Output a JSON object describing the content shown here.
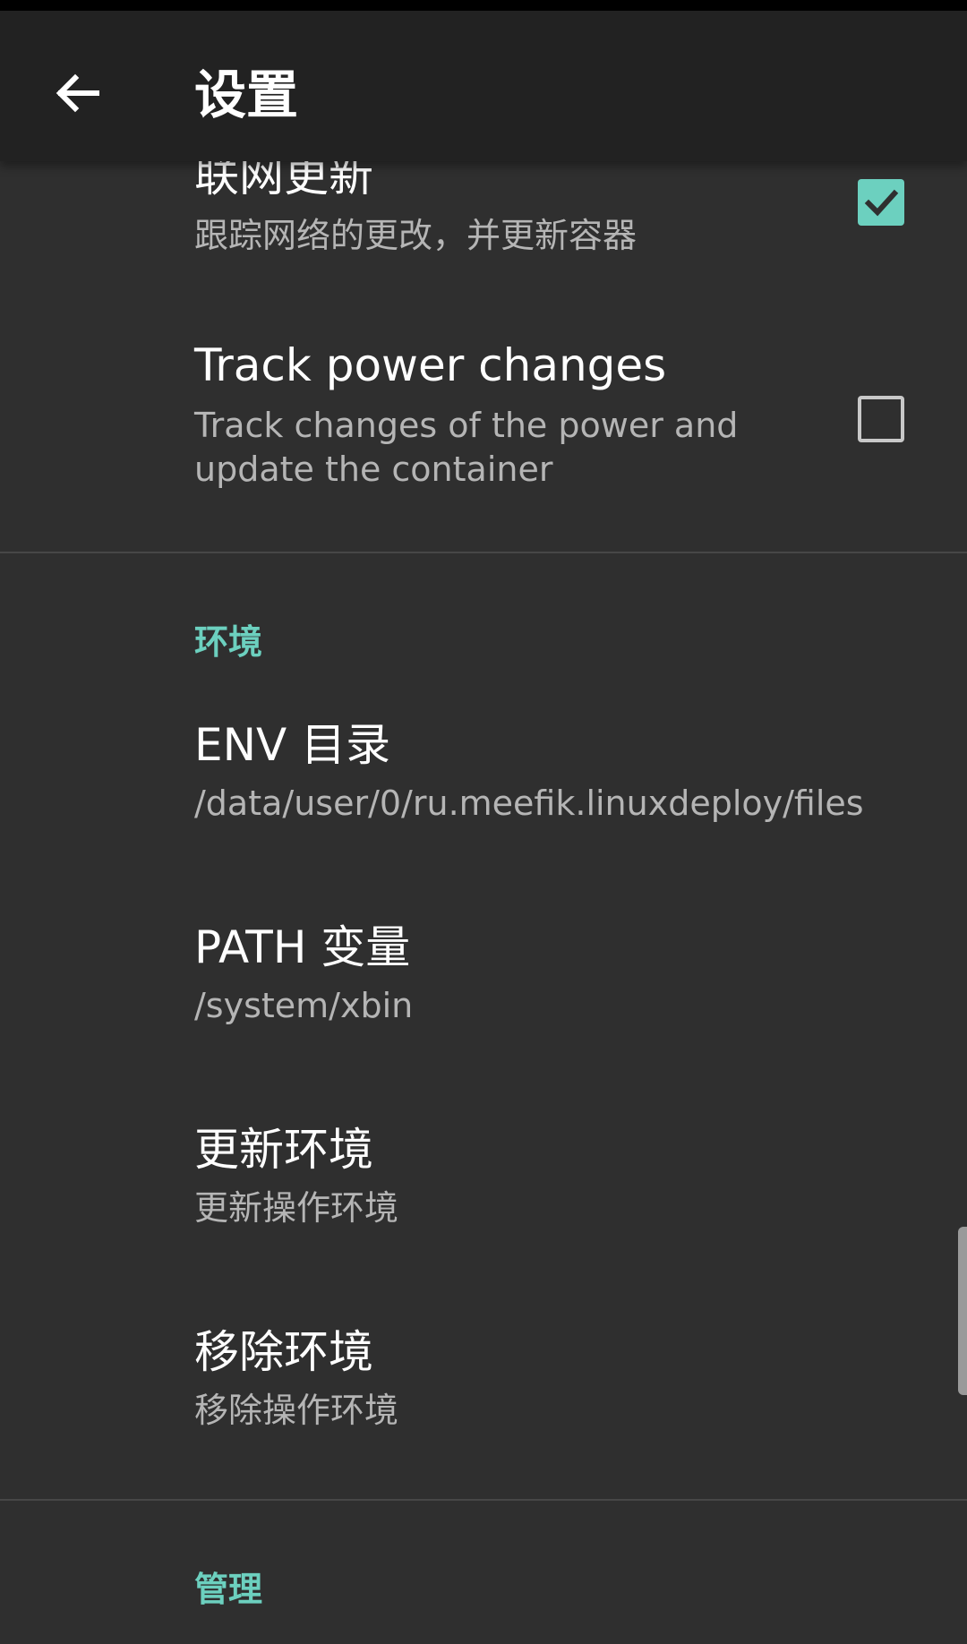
{
  "app_bar": {
    "title": "设置",
    "back_icon": "arrow-back-icon"
  },
  "preferences": {
    "network_update": {
      "title": "联网更新",
      "summary": "跟踪网络的更改，并更新容器",
      "checked": true
    },
    "track_power": {
      "title": "Track power changes",
      "summary_line1": "Track changes of the power and",
      "summary_line2": "update the container",
      "checked": false
    }
  },
  "sections": {
    "environment": {
      "header": "环境",
      "items": [
        {
          "title": "ENV 目录",
          "summary": "/data/user/0/ru.meefik.linuxdeploy/files"
        },
        {
          "title": "PATH 变量",
          "summary": "/system/xbin"
        },
        {
          "title": "更新环境",
          "summary": "更新操作环境"
        },
        {
          "title": "移除环境",
          "summary": "移除操作环境"
        }
      ]
    },
    "management": {
      "header": "管理"
    }
  },
  "colors": {
    "accent": "#6cd0bf",
    "background": "#2f2f2f",
    "app_bar": "#222222",
    "summary_text": "#b5b5b5"
  }
}
